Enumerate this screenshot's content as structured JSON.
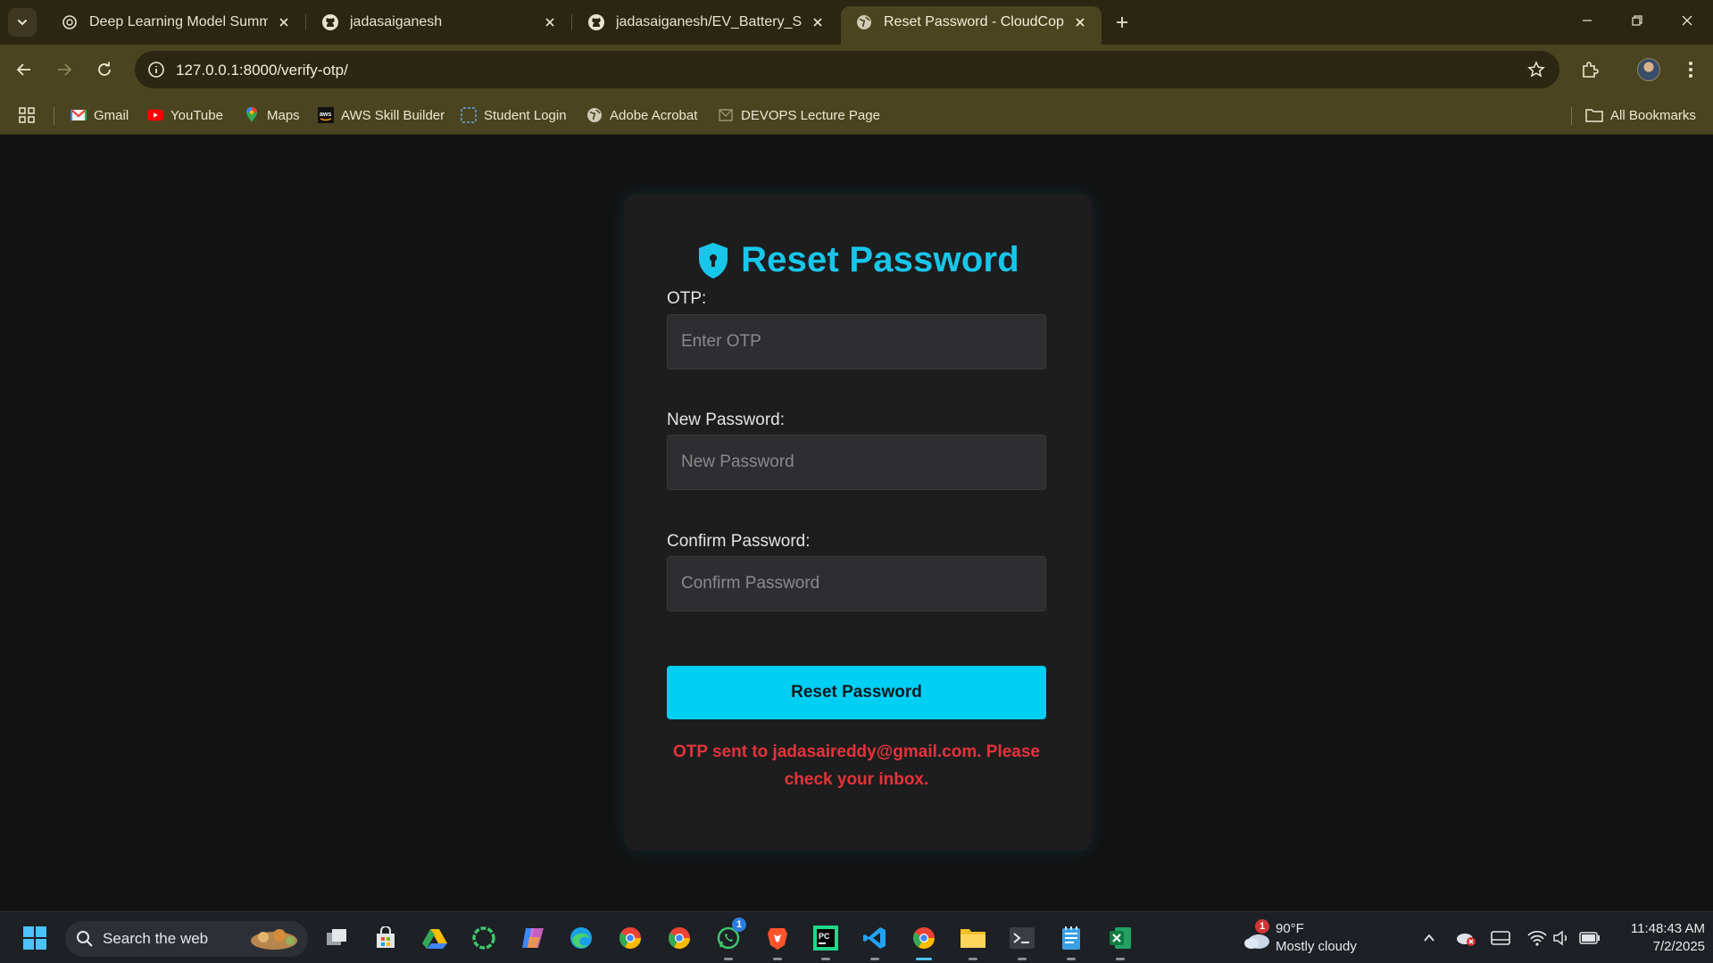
{
  "browser": {
    "tabs": [
      {
        "title": "Deep Learning Model Summary",
        "icon": "chatgpt-icon"
      },
      {
        "title": "jadasaiganesh",
        "icon": "github-icon"
      },
      {
        "title": "jadasaiganesh/EV_Battery_SOH_",
        "icon": "github-icon"
      },
      {
        "title": "Reset Password - CloudCopilot",
        "icon": "globe-icon",
        "active": true
      }
    ],
    "url": "127.0.0.1:8000/verify-otp/",
    "bookmarks": [
      {
        "label": "Gmail",
        "icon": "gmail-icon"
      },
      {
        "label": "YouTube",
        "icon": "youtube-icon"
      },
      {
        "label": "Maps",
        "icon": "maps-icon"
      },
      {
        "label": "AWS Skill Builder",
        "icon": "aws-icon"
      },
      {
        "label": "Student Login",
        "icon": "student-login-icon"
      },
      {
        "label": "Adobe Acrobat",
        "icon": "globe-icon"
      },
      {
        "label": "DEVOPS Lecture Page",
        "icon": "devops-icon"
      }
    ],
    "all_bookmarks": "All Bookmarks"
  },
  "form": {
    "title": "Reset Password",
    "otp_label": "OTP:",
    "otp_placeholder": "Enter OTP",
    "otp_value": "",
    "new_password_label": "New Password:",
    "new_password_placeholder": "New Password",
    "confirm_password_label": "Confirm Password:",
    "confirm_password_placeholder": "Confirm Password",
    "submit_label": "Reset Password",
    "message": "OTP sent to jadasaireddy@gmail.com. Please check your inbox.",
    "accent_color": "#00cff4",
    "message_color": "#e5333a"
  },
  "taskbar": {
    "search_placeholder": "Search the web",
    "weather_temp": "90°F",
    "weather_desc": "Mostly cloudy",
    "weather_badge": "1",
    "whatsapp_badge": "1",
    "time": "11:48:43 AM",
    "date": "7/2/2025"
  }
}
